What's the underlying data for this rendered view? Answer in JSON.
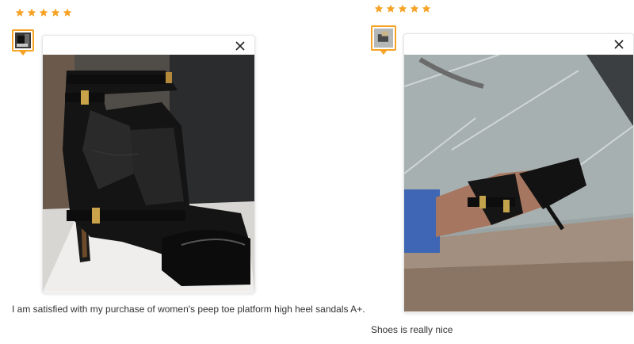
{
  "reviews": [
    {
      "rating": 5,
      "rating_max": 5,
      "star_color": "#f7a326",
      "thumbnail_icon": "photo-thumbnail-icon",
      "close_icon": "close-icon",
      "text": "I am satisfied with my purchase of women's peep toe platform high heel sandals A+."
    },
    {
      "rating": 5,
      "rating_max": 5,
      "star_color": "#f7a326",
      "thumbnail_icon": "photo-thumbnail-icon",
      "close_icon": "close-icon",
      "text": "Shoes is really nice"
    }
  ]
}
